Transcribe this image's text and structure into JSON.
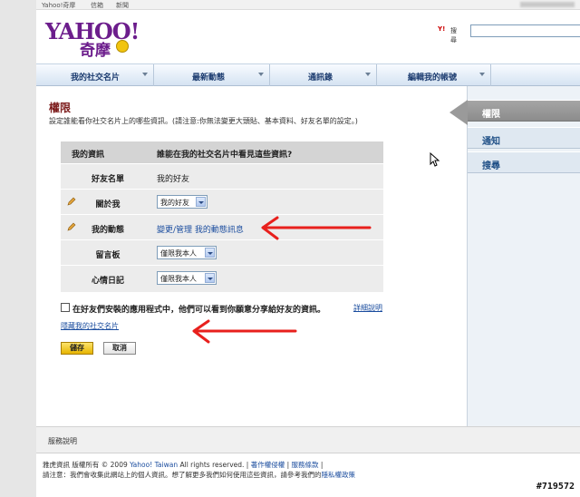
{
  "top_links": [
    "Yahoo!奇摩",
    "信箱",
    "新聞"
  ],
  "logo": {
    "word": "YAHOO!",
    "cn": "奇摩"
  },
  "search": {
    "label": "搜尋",
    "value": ""
  },
  "nav": [
    {
      "label": "我的社交名片"
    },
    {
      "label": "最新動態"
    },
    {
      "label": "通訊錄"
    },
    {
      "label": "編輯我的帳號"
    }
  ],
  "sidebar": [
    {
      "label": "權限",
      "active": true
    },
    {
      "label": "通知",
      "active": false
    },
    {
      "label": "搜尋",
      "active": false
    }
  ],
  "page": {
    "title": "權限",
    "description": "設定誰能看你社交名片上的哪些資訊。(請注意:你無法變更大頭貼、基本資料、好友名單的設定。)"
  },
  "table": {
    "col_info": "我的資訊",
    "col_who": "誰能在我的社交名片中看見這些資訊?",
    "rows": [
      {
        "name": "好友名單",
        "value": "我的好友",
        "type": "text"
      },
      {
        "name": "關於我",
        "value": "我的好友",
        "type": "select",
        "editable": true
      },
      {
        "name": "我的動態",
        "value": "變更/管理 我的動態訊息",
        "type": "link",
        "editable": true
      },
      {
        "name": "留言板",
        "value": "僅限我本人",
        "type": "select"
      },
      {
        "name": "心情日記",
        "value": "僅限我本人",
        "type": "select"
      }
    ]
  },
  "apps_option": {
    "label": "在好友們安裝的應用程式中，他們可以看到你願意分享給好友的資訊。",
    "help": "詳細說明",
    "checked": false
  },
  "hide_card_link": "隱藏我的社交名片",
  "buttons": {
    "save": "儲存",
    "cancel": "取消"
  },
  "footer": {
    "links_label": "服務說明",
    "copy_prefix": "雅虎資訊  版權所有 © 2009 ",
    "copy_brand": "Yahoo! Taiwan",
    "copy_suffix": " All rights reserved. | ",
    "copy_l1": "著作權侵權",
    "copy_sep": " | ",
    "copy_l2": "服務條款",
    "copy_end": " |",
    "notice_prefix": "請注意：我們會收集此網站上的個人資訊。想了解更多我們如何使用這些資訊，請參考我們的",
    "notice_link": "隱私權政策"
  },
  "stamp": "#719572",
  "colors": {
    "brand": "#6c1d8c",
    "annotation_red": "#e8201d",
    "link": "#1a4c9e",
    "title": "#7b1a1a"
  }
}
